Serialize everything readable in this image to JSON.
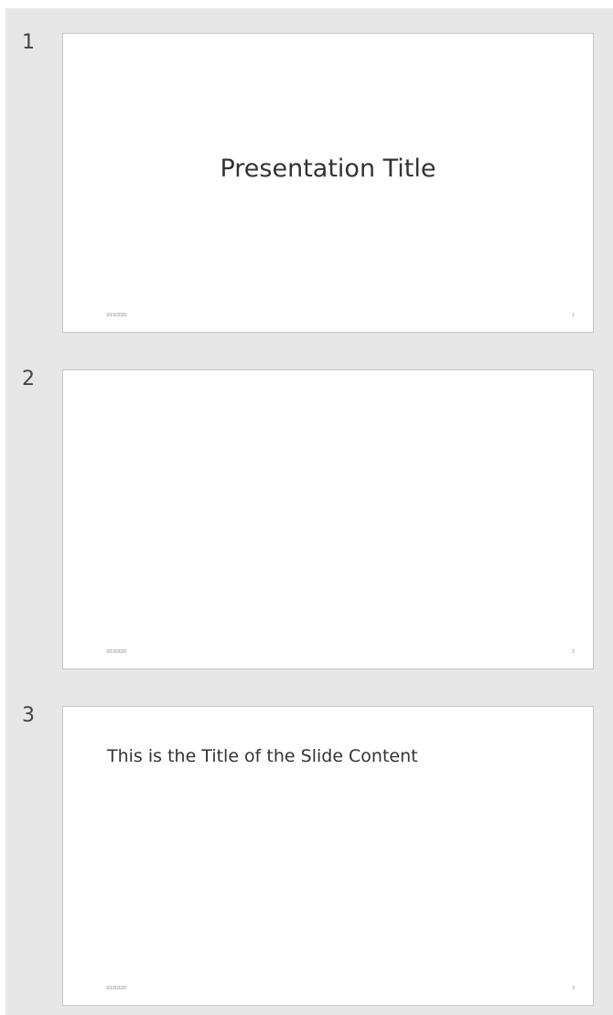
{
  "slides": [
    {
      "number": "1",
      "title": "Presentation Title",
      "footer_date": "3/19/2020",
      "footer_page": "1"
    },
    {
      "number": "2",
      "title": "",
      "footer_date": "3/19/2020",
      "footer_page": "2"
    },
    {
      "number": "3",
      "title": "This is the Title of the Slide Content",
      "footer_date": "3/19/2020",
      "footer_page": "3"
    }
  ]
}
